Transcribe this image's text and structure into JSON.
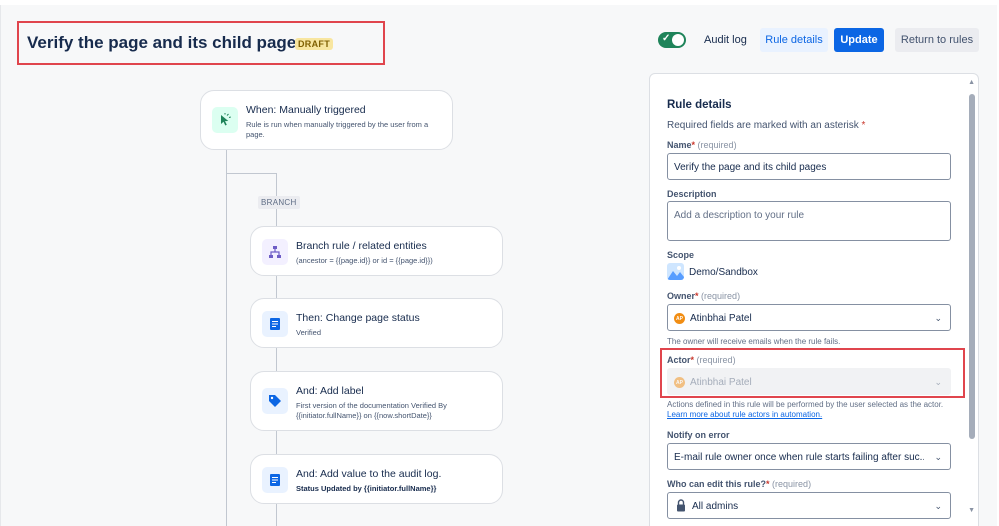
{
  "header": {
    "title": "Verify the page and its child pages",
    "badge": "DRAFT",
    "audit_log_label": "Audit log",
    "rule_details_button": "Rule details",
    "update_button": "Update",
    "return_button": "Return to rules"
  },
  "flow": {
    "trigger": {
      "title": "When: Manually triggered",
      "subtitle": "Rule is run when manually triggered by the user from a page.",
      "icon": "cursor-click-icon"
    },
    "branch_label": "BRANCH",
    "steps": [
      {
        "title": "Branch rule / related entities",
        "subtitle": "(ancestor = {{page.id}} or id = {{page.id}})",
        "icon": "hierarchy-icon"
      },
      {
        "title": "Then: Change page status",
        "subtitle": "Verified",
        "icon": "page-icon"
      },
      {
        "title": "And: Add label",
        "subtitle": "First version of the documentation Verified By {{initiator.fullName}} on {{now.shortDate}}",
        "icon": "tag-icon"
      },
      {
        "title": "And: Add value to the audit log.",
        "subtitle": "Status Updated by {{initiator.fullName}}",
        "icon": "page-icon"
      }
    ]
  },
  "panel": {
    "heading": "Rule details",
    "required_note": "Required fields are marked with an asterisk",
    "name": {
      "label": "Name",
      "hint": "(required)",
      "value": "Verify the page and its child pages"
    },
    "description": {
      "label": "Description",
      "placeholder": "Add a description to your rule"
    },
    "scope": {
      "label": "Scope",
      "value": "Demo/Sandbox"
    },
    "owner": {
      "label": "Owner",
      "hint": "(required)",
      "value": "Atinbhai Patel",
      "initials": "AP",
      "help": "The owner will receive emails when the rule fails."
    },
    "actor": {
      "label": "Actor",
      "hint": "(required)",
      "value": "Atinbhai Patel",
      "initials": "AP",
      "help": "Actions defined in this rule will be performed by the user selected as the actor.",
      "link": "Learn more about rule actors in automation."
    },
    "notify": {
      "label": "Notify on error",
      "value": "E-mail rule owner once when rule starts failing after suc..."
    },
    "who_can_edit": {
      "label": "Who can edit this rule?",
      "hint": "(required)",
      "value": "All admins"
    }
  },
  "colors": {
    "accent": "#0c66e4",
    "toggle_on": "#1f845a",
    "highlight": "#e0454d",
    "draft": "#f8e6a0"
  }
}
